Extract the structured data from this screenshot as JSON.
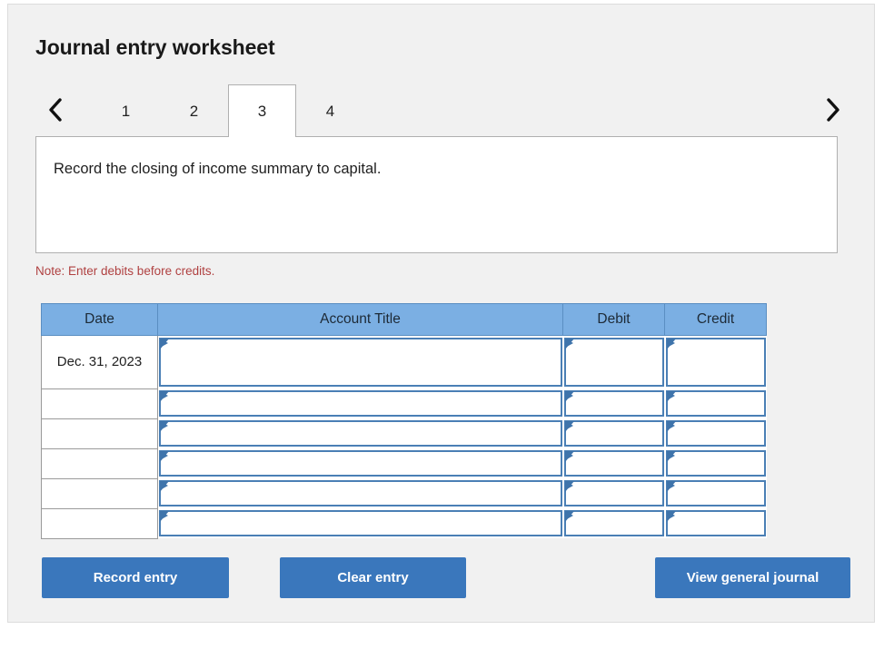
{
  "worksheet": {
    "title": "Journal entry worksheet",
    "nav": {
      "prev_icon": "chevron-left-icon",
      "next_icon": "chevron-right-icon"
    },
    "tabs": [
      {
        "label": "1",
        "active": false
      },
      {
        "label": "2",
        "active": false
      },
      {
        "label": "3",
        "active": true
      },
      {
        "label": "4",
        "active": false
      }
    ],
    "instruction": "Record the closing of income summary to capital.",
    "note": "Note: Enter debits before credits."
  },
  "table": {
    "headers": {
      "date": "Date",
      "account_title": "Account Title",
      "debit": "Debit",
      "credit": "Credit"
    },
    "rows": [
      {
        "date": "Dec. 31, 2023",
        "account_title": "",
        "debit": "",
        "credit": ""
      },
      {
        "date": "",
        "account_title": "",
        "debit": "",
        "credit": ""
      },
      {
        "date": "",
        "account_title": "",
        "debit": "",
        "credit": ""
      },
      {
        "date": "",
        "account_title": "",
        "debit": "",
        "credit": ""
      },
      {
        "date": "",
        "account_title": "",
        "debit": "",
        "credit": ""
      },
      {
        "date": "",
        "account_title": "",
        "debit": "",
        "credit": ""
      }
    ]
  },
  "buttons": {
    "record": "Record entry",
    "clear": "Clear entry",
    "view_journal": "View general journal"
  },
  "colors": {
    "header_blue": "#7bafe3",
    "button_blue": "#3a77bc",
    "note_red": "#b04141",
    "card_background": "#f1f1f1",
    "input_border_blue": "#4a7fb5"
  }
}
